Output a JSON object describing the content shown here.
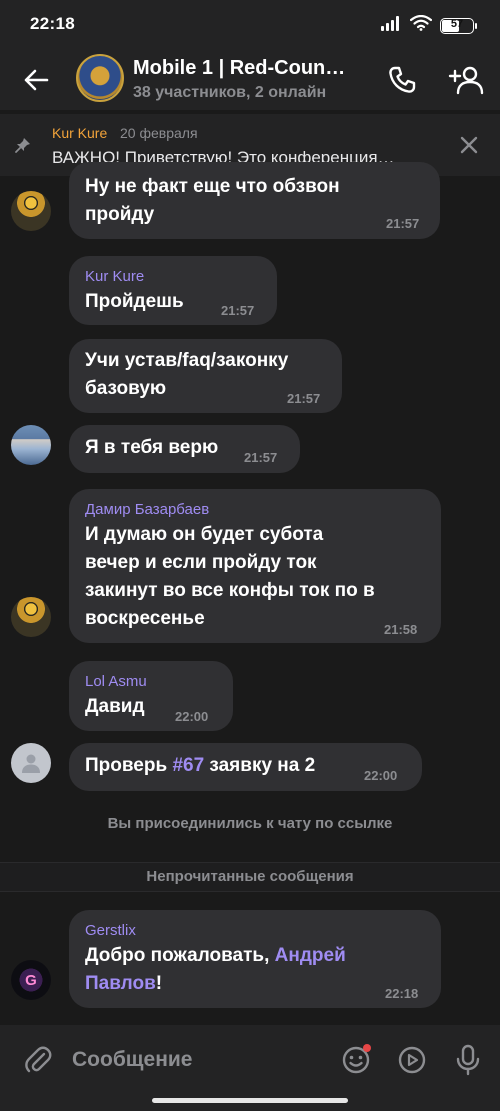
{
  "status_bar": {
    "time": "22:18",
    "battery": "57",
    "battery_level": 0.57,
    "icons": [
      "signal-icon",
      "wifi-icon",
      "battery-icon"
    ]
  },
  "header": {
    "title": "Mobile 1 | Red-Coun…",
    "subtitle": "38 участников, 2 онлайн",
    "icons": [
      "back-arrow-icon",
      "phone-icon",
      "add-user-icon"
    ]
  },
  "pinned": {
    "author": "Kur Kure",
    "date": "20 февраля",
    "text": "ВАЖНО! Приветствую! Это конференция…",
    "icons": [
      "pin-icon",
      "close-icon"
    ]
  },
  "messages": [
    {
      "author": "",
      "lines": [
        "Ну не факт еще что обзвон",
        "пройду"
      ],
      "time": "21:57"
    },
    {
      "author": "Kur Kure",
      "lines": [
        "Пройдешь"
      ],
      "time": "21:57"
    },
    {
      "author": "",
      "lines": [
        "Учи устав/faq/законку",
        "базовую"
      ],
      "time": "21:57"
    },
    {
      "author": "",
      "lines": [
        "Я в тебя верю"
      ],
      "time": "21:57"
    },
    {
      "author": "Дамир Базарбаев",
      "lines": [
        "И думаю он будет субота",
        "вечер и если пройду ток",
        "закинут во все конфы ток по в",
        "воскресенье"
      ],
      "time": "21:58"
    },
    {
      "author": "Lol Asmu",
      "lines": [
        "Давид"
      ],
      "time": "22:00"
    },
    {
      "author": "",
      "text_before": "Проверь ",
      "tag": "#67",
      "text_after": " заявку на 2",
      "time": "22:00"
    },
    {
      "author": "Gerstlix",
      "text_before": "Добро пожаловать, ",
      "mention_1": "Андрей",
      "mention_2": "Павлов",
      "text_after": "!",
      "time": "22:18"
    }
  ],
  "system": {
    "joined_note": "Вы присоединились к чату по ссылке",
    "unread_label": "Непрочитанные сообщения"
  },
  "avatars": {
    "gerstlix_letter": "G"
  },
  "composer": {
    "placeholder": "Сообщение",
    "icons": [
      "attach-icon",
      "emoji-icon",
      "stickers-icon",
      "mic-icon"
    ]
  },
  "colors": {
    "background": "#1a1a1a",
    "panel": "#232324",
    "bubble": "#303033",
    "author_accent": "#9f8cf2",
    "pinned_author": "#f2a33a",
    "muted_text": "#8c8d91"
  }
}
